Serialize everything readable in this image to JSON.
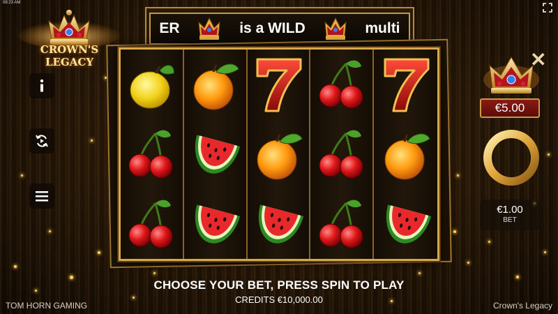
{
  "status_bar": {
    "time": "08:23 AM"
  },
  "logo": {
    "text": "CROWN'S LEGACY"
  },
  "banner": {
    "segments": [
      "ER",
      "is a WILD",
      "multi"
    ]
  },
  "side_menu": {
    "info_icon": "info-icon",
    "autoplay_icon": "autoplay-icon",
    "menu_icon": "hamburger-menu-icon"
  },
  "reels": [
    [
      "lemon",
      "cherries",
      "cherries"
    ],
    [
      "orange",
      "watermelon",
      "watermelon"
    ],
    [
      "seven",
      "orange",
      "watermelon"
    ],
    [
      "cherries",
      "cherries",
      "cherries"
    ],
    [
      "seven",
      "orange",
      "watermelon"
    ]
  ],
  "feature": {
    "price": "€5.00"
  },
  "bet": {
    "value": "€1.00",
    "label": "BET"
  },
  "message": "CHOOSE YOUR BET, PRESS SPIN TO PLAY",
  "credits": "CREDITS €10,000.00",
  "footer": {
    "provider": "TOM HORN GAMING",
    "game_name": "Crown's Legacy"
  },
  "colors": {
    "gold": "#d6a84a",
    "dark_red": "#8a1a14",
    "background": "#2b1a08"
  }
}
